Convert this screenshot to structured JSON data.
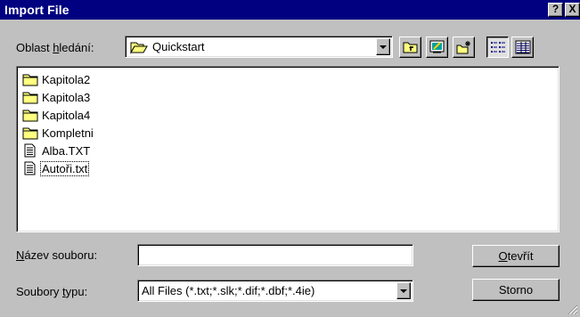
{
  "window": {
    "title": "Import File",
    "help_button": "?",
    "close_button": "X"
  },
  "look_in": {
    "label_prefix": "Oblast ",
    "label_accel": "h",
    "label_suffix": "ledání:",
    "value": "Quickstart"
  },
  "toolbar": {
    "up_icon": "up-one-level-icon",
    "desktop_icon": "desktop-icon",
    "new_folder_icon": "new-folder-icon",
    "list_view_icon": "list-view-icon",
    "details_view_icon": "details-view-icon"
  },
  "files": [
    {
      "name": "Kapitola2",
      "type": "folder"
    },
    {
      "name": "Kapitola3",
      "type": "folder"
    },
    {
      "name": "Kapitola4",
      "type": "folder"
    },
    {
      "name": "Kompletni",
      "type": "folder"
    },
    {
      "name": "Alba.TXT",
      "type": "text-file"
    },
    {
      "name": "Autoři.txt",
      "type": "text-file"
    }
  ],
  "file_name": {
    "label_accel": "N",
    "label_rest": "ázev souboru:",
    "value": ""
  },
  "file_type": {
    "label_prefix": "Soubory ",
    "label_accel": "t",
    "label_suffix": "ypu:",
    "value": "All Files (*.txt;*.slk;*.dif;*.dbf;*.4ie)"
  },
  "buttons": {
    "open_accel": "O",
    "open_rest": "tevřít",
    "cancel": "Storno"
  },
  "colors": {
    "titlebar": "#000080",
    "face": "#c0c0c0",
    "folder": "#ffff80"
  }
}
